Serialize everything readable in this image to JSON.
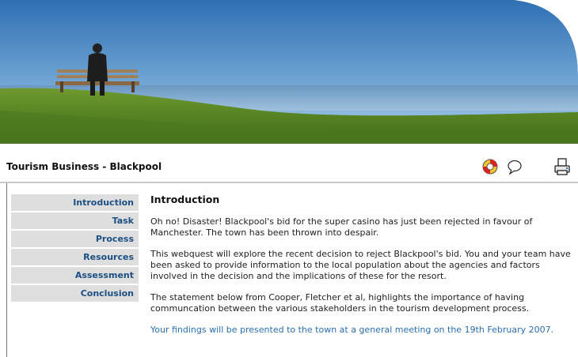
{
  "site": {
    "title": "Tourism Business - Blackpool"
  },
  "toolbar": {
    "icons": [
      "lifebuoy-icon",
      "speech-bubble-icon",
      "printer-icon"
    ]
  },
  "nav": {
    "items": [
      {
        "label": "Introduction"
      },
      {
        "label": "Task"
      },
      {
        "label": "Process"
      },
      {
        "label": "Resources"
      },
      {
        "label": "Assessment"
      },
      {
        "label": "Conclusion"
      }
    ]
  },
  "main": {
    "heading": "Introduction",
    "paragraphs": [
      "Oh no! Disaster! Blackpool's bid for the super casino has just been rejected in favour of Manchester. The town has been thrown into despair.",
      "This webquest will explore the recent decision to reject Blackpool's bid. You and your team have been asked to provide information to the local population about the agencies and factors involved in the decision and the implications of these for the resort.",
      "The statement below from Cooper, Fletcher et al, highlights the importance of having communcation between the various stakeholders in the tourism development process.",
      "Your findings will be presented to the town at a general meeting on the 19th February 2007."
    ]
  },
  "colors": {
    "nav_text": "#1c4f82",
    "nav_bg": "#dedede",
    "link_blue": "#2a6fb0"
  }
}
